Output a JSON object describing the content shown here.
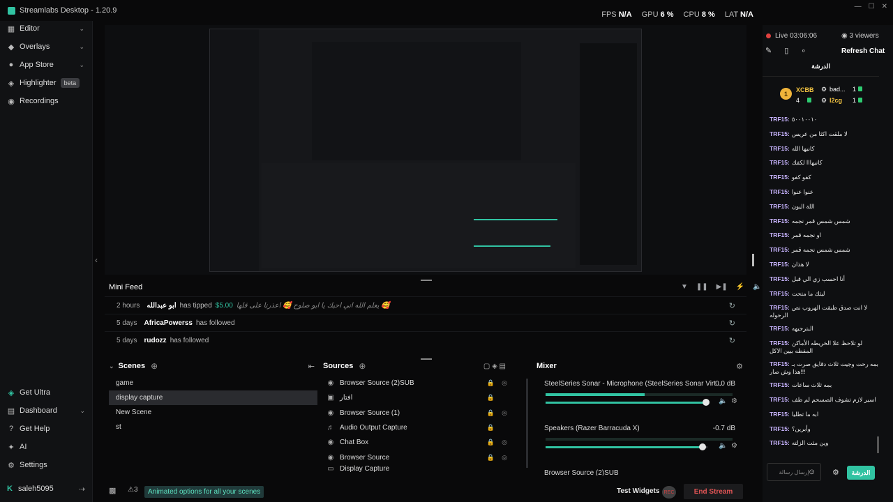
{
  "app": {
    "title": "Streamlabs Desktop - 1.20.9"
  },
  "stats": [
    {
      "label": "FPS",
      "value": "N/A"
    },
    {
      "label": "GPU",
      "value": "6 %"
    },
    {
      "label": "CPU",
      "value": "8 %"
    },
    {
      "label": "LAT",
      "value": "N/A"
    }
  ],
  "sidebar": {
    "items": [
      {
        "label": "Editor",
        "icon": "editor-icon"
      },
      {
        "label": "Overlays",
        "icon": "overlays-icon"
      },
      {
        "label": "App Store",
        "icon": "app-store-icon"
      },
      {
        "label": "Highlighter",
        "badge": "beta",
        "icon": "highlighter-icon"
      },
      {
        "label": "Recordings",
        "icon": "recordings-icon"
      }
    ],
    "bottom_items": [
      {
        "label": "Get Ultra"
      },
      {
        "label": "Dashboard"
      },
      {
        "label": "Get Help"
      },
      {
        "label": "AI"
      },
      {
        "label": "Settings"
      }
    ],
    "user": "saleh5095"
  },
  "minifeed": {
    "title": "Mini Feed",
    "items": [
      {
        "time": "2 hours",
        "name": "ابو عبدالله",
        "action": "has tipped",
        "amount": "$5.00",
        "message": "يعلم الله اني احبك يا ابو صلوح 🥰 اعذرنا على قلها 🥰"
      },
      {
        "time": "5 days",
        "name": "AfricaPowerss",
        "action": "has followed"
      },
      {
        "time": "5 days",
        "name": "rudozz",
        "action": "has followed"
      }
    ]
  },
  "scenes": {
    "title": "Scenes",
    "items": [
      "game",
      "display capture",
      "New Scene",
      "st"
    ],
    "selected": 1
  },
  "sources": {
    "title": "Sources",
    "items": [
      "Browser Source (2)SUB",
      "افتار",
      "Browser Source (1)",
      "Audio Output Capture",
      "Chat Box",
      "Browser Source",
      "Display Capture"
    ]
  },
  "mixer": {
    "title": "Mixer",
    "items": [
      {
        "name": "SteelSeries Sonar - Microphone (SteelSeries Sonar Virt...",
        "db": "0.0 dB",
        "level": 0.53,
        "volume": 0.99
      },
      {
        "name": "Speakers (Razer Barracuda X)",
        "db": "-0.7 dB",
        "level": 0.0,
        "volume": 0.97
      },
      {
        "name": "Browser Source (2)SUB",
        "db": ""
      }
    ]
  },
  "bottombar": {
    "notif_count": "3",
    "announcement": "Animated options for all your scenes",
    "test_widgets": "Test Widgets",
    "rec": "REC",
    "end_stream": "End Stream"
  },
  "chat": {
    "live": "Live 03:06:06",
    "viewers": "3 viewers",
    "refresh": "Refresh Chat",
    "header": "الدرشة",
    "donors": [
      {
        "rank": "1",
        "name": "XCBB",
        "count": "4"
      },
      {
        "name": "bad...",
        "count": "1"
      },
      {
        "name": "l2cg",
        "count": "1"
      }
    ],
    "messages": [
      {
        "user": "TRF15:",
        "text": "٥٠٠١٠٠١٠"
      },
      {
        "user": "TRF15:",
        "text": "لا ملقت اكثا من عريس"
      },
      {
        "user": "TRF15:",
        "text": "كانيها الله"
      },
      {
        "user": "TRF15:",
        "text": "كانيهااا لكفك"
      },
      {
        "user": "TRF15:",
        "text": "كفو كفو"
      },
      {
        "user": "TRF15:",
        "text": "عنوا عنوا"
      },
      {
        "user": "TRF15:",
        "text": "اللة اليون"
      },
      {
        "user": "TRF15:",
        "text": "شمس شمس قمر نجمه"
      },
      {
        "user": "TRF15:",
        "text": "او نجمه قمر"
      },
      {
        "user": "TRF15:",
        "text": "شمس شمس نجمه قمر"
      },
      {
        "user": "TRF15:",
        "text": "لا هذان"
      },
      {
        "user": "TRF15:",
        "text": "أنا احسب زي الي قبل"
      },
      {
        "user": "TRF15:",
        "text": "ليثك ما متحت"
      },
      {
        "user": "TRF15:",
        "text": "لا انت صدق طبقت الهروب نص الرحوله",
        "tall": true
      },
      {
        "user": "TRF15:",
        "text": "البترجيهه"
      },
      {
        "user": "TRF15:",
        "text": "لو تلاحظ علا الخريطه الأماكن المفطه بيين الاكل",
        "tall": true
      },
      {
        "user": "TRF15:",
        "text": "بمه رحت وجيت ثلاث دقايق صرت بـ !!!هذا وش صار",
        "tall": true
      },
      {
        "user": "TRF15:",
        "text": "بمه ثلاث ساعات"
      },
      {
        "user": "TRF15:",
        "text": "اسير لازم تشوف الصسحم لم طف"
      },
      {
        "user": "TRF15:",
        "text": "ابه ما تطليا"
      },
      {
        "user": "TRF15:",
        "text": "وأبرين؟"
      },
      {
        "user": "TRF15:",
        "text": "وين مثت الزلته"
      }
    ],
    "input_placeholder": "إرسال رسالة",
    "send": "الدرشة"
  }
}
